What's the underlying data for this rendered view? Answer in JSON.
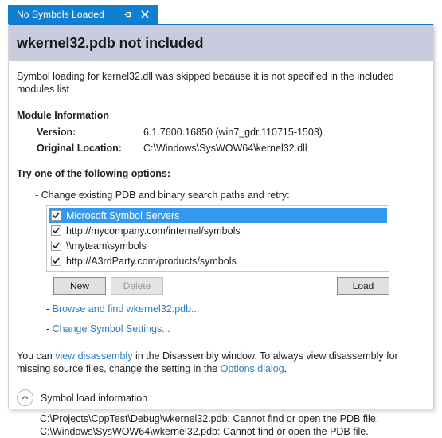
{
  "tab": {
    "title": "No Symbols Loaded",
    "pin_icon": "pin-icon",
    "close_icon": "close-icon"
  },
  "banner": {
    "title": "wkernel32.pdb not included"
  },
  "intro": "Symbol loading for kernel32.dll was skipped because it is not specified in the included modules list",
  "module_information": {
    "heading": "Module Information",
    "rows": [
      {
        "label": "Version:",
        "value": "6.1.7600.16850 (win7_gdr.110715-1503)"
      },
      {
        "label": "Original Location:",
        "value": "C:\\Windows\\SysWOW64\\kernel32.dll"
      }
    ]
  },
  "options": {
    "heading": "Try one of the following options:",
    "sub_option": "- Change existing PDB and binary search paths and retry:"
  },
  "symbol_paths": [
    {
      "label": "Microsoft Symbol Servers",
      "checked": true,
      "selected": true
    },
    {
      "label": "http://mycompany.com/internal/symbols",
      "checked": true,
      "selected": false
    },
    {
      "label": "\\\\myteam\\symbols",
      "checked": true,
      "selected": false
    },
    {
      "label": "http://A3rdParty.com/products/symbols",
      "checked": true,
      "selected": false
    }
  ],
  "buttons": {
    "new": "New",
    "delete": "Delete",
    "load": "Load"
  },
  "links": {
    "browse_prefix": "- ",
    "browse": "Browse and find wkernel32.pdb...",
    "settings_prefix": "- ",
    "settings": "Change Symbol Settings..."
  },
  "disassembly": {
    "part1": "You can ",
    "link1": "view disassembly",
    "part2": " in the Disassembly window. To always view disassembly for missing source files, change the setting in the ",
    "link2": "Options dialog",
    "part3": "."
  },
  "symbol_load": {
    "expander_label": "Symbol load information",
    "expander_icon": "chevron-up-icon",
    "lines": [
      "C:\\Projects\\CppTest\\Debug\\wkernel32.pdb: Cannot find or open the PDB file.",
      "C:\\Windows\\SysWOW64\\wkernel32.pdb: Cannot find or open the PDB file."
    ]
  },
  "colors": {
    "tab_blue": "#0f7fcf",
    "banner_bg": "#c9cbdf",
    "banner_rule": "#1573c6",
    "selection_blue": "#3399f0",
    "link_blue": "#2e7cc4"
  }
}
